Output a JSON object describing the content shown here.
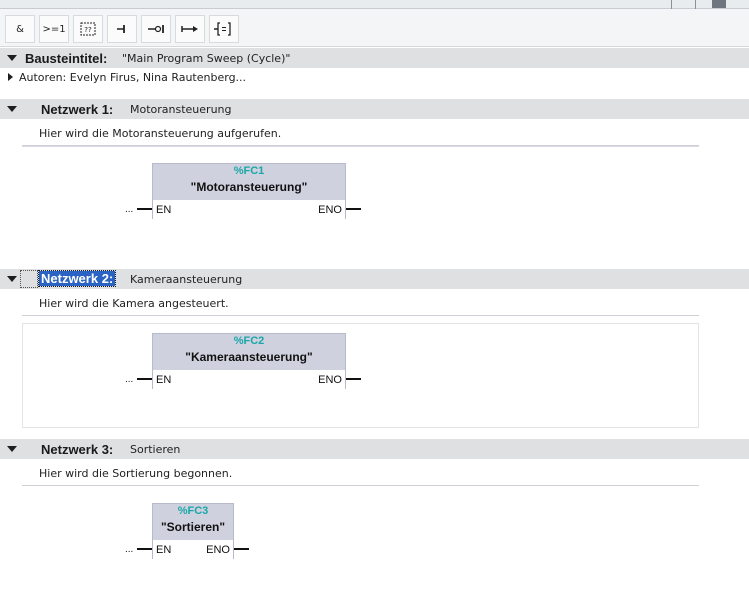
{
  "toolbar": {
    "buttons": [
      {
        "name": "and-box-button",
        "label": "&"
      },
      {
        "name": "or-box-button",
        "label": ">=1"
      },
      {
        "name": "empty-box-button",
        "label": "??"
      },
      {
        "name": "open-branch-button",
        "label": ""
      },
      {
        "name": "negate-button",
        "label": ""
      },
      {
        "name": "assign-button",
        "label": ""
      },
      {
        "name": "set-coil-button",
        "label": ""
      }
    ]
  },
  "block": {
    "title_label": "Bausteintitel:",
    "title_value": "\"Main Program Sweep (Cycle)\"",
    "authors": "Autoren: Evelyn Firus, Nina Rautenberg..."
  },
  "networks": [
    {
      "label": "Netzwerk 1:",
      "title": "Motoransteuerung",
      "comment": "Hier wird die Motoransteuerung aufgerufen.",
      "fc_number": "%FC1",
      "fc_name": "\"Motoransteuerung\"",
      "en": "EN",
      "eno": "ENO",
      "input": "..."
    },
    {
      "label": "Netzwerk 2:",
      "title": "Kameraansteuerung",
      "comment": "Hier wird die Kamera angesteuert.",
      "fc_number": "%FC2",
      "fc_name": "\"Kameraansteuerung\"",
      "en": "EN",
      "eno": "ENO",
      "input": "...",
      "selected": true
    },
    {
      "label": "Netzwerk 3:",
      "title": "Sortieren",
      "comment": "Hier wird die Sortierung begonnen.",
      "fc_number": "%FC3",
      "fc_name": "\"Sortieren\"",
      "en": "EN",
      "eno": "ENO",
      "input": "..."
    }
  ]
}
